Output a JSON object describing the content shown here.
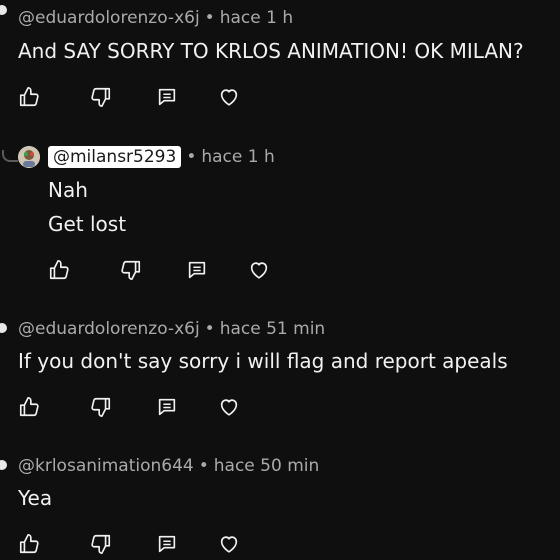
{
  "comments": [
    {
      "author": "@eduardolorenzo-x6j",
      "time": "hace 1 h",
      "lines": [
        "And SAY SORRY TO KRLOS ANIMATION! OK MILAN?"
      ]
    },
    {
      "author": "@milansr5293",
      "time": "hace 1 h",
      "lines": [
        "Nah",
        "Get lost"
      ]
    },
    {
      "author": "@eduardolorenzo-x6j",
      "time": "hace 51 min",
      "lines": [
        "If you don't say sorry i will flag and report apeals"
      ]
    },
    {
      "author": "@krlosanimation644",
      "time": "hace 50 min",
      "lines": [
        "Yea"
      ]
    }
  ],
  "separator": "•",
  "icons": {
    "like": "thumbs-up-icon",
    "dislike": "thumbs-down-icon",
    "reply": "reply-icon",
    "heart": "heart-icon"
  },
  "colors": {
    "background": "#0f0f0f",
    "text": "#f1f1f1",
    "meta": "#aaaaaa",
    "chip_bg": "#ffffff"
  }
}
